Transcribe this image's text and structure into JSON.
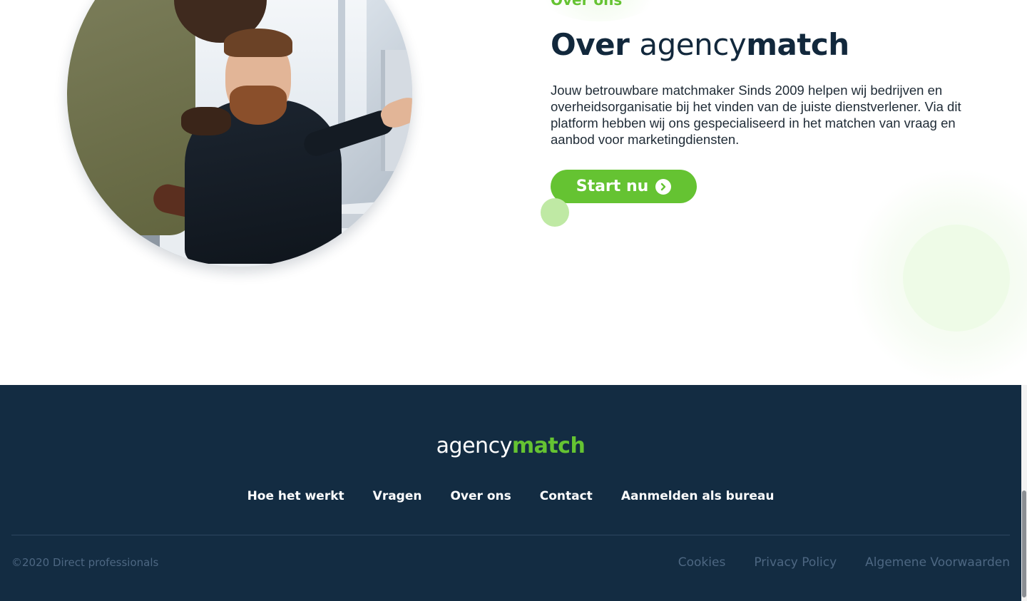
{
  "about": {
    "eyebrow": "Over ons",
    "title_part1": "Over ",
    "title_part2": "agency",
    "title_part3": "match",
    "description": "Jouw betrouwbare matchmaker Sinds 2009 helpen wij bedrijven en overheidsorganisatie bij het vinden van de juiste dienstverlener. Via dit platform hebben wij ons gespecialiseerd in het matchen van vraag en aanbod voor marketingdiensten.",
    "cta_label": "Start nu",
    "cta_icon": "chevron-right-circle-icon"
  },
  "footer": {
    "logo_part1": "agency",
    "logo_part2": "match",
    "nav": [
      {
        "label": "Hoe het werkt"
      },
      {
        "label": "Vragen"
      },
      {
        "label": "Over ons"
      },
      {
        "label": "Contact"
      },
      {
        "label": "Aanmelden als bureau"
      }
    ],
    "copyright": "©2020 Direct professionals",
    "legal": [
      {
        "label": "Cookies"
      },
      {
        "label": "Privacy Policy"
      },
      {
        "label": "Algemene Voorwaarden"
      }
    ]
  },
  "colors": {
    "brand_green": "#65c332",
    "navy": "#12283c",
    "footer_bg": "#132c42",
    "footer_muted": "#4d6782"
  }
}
